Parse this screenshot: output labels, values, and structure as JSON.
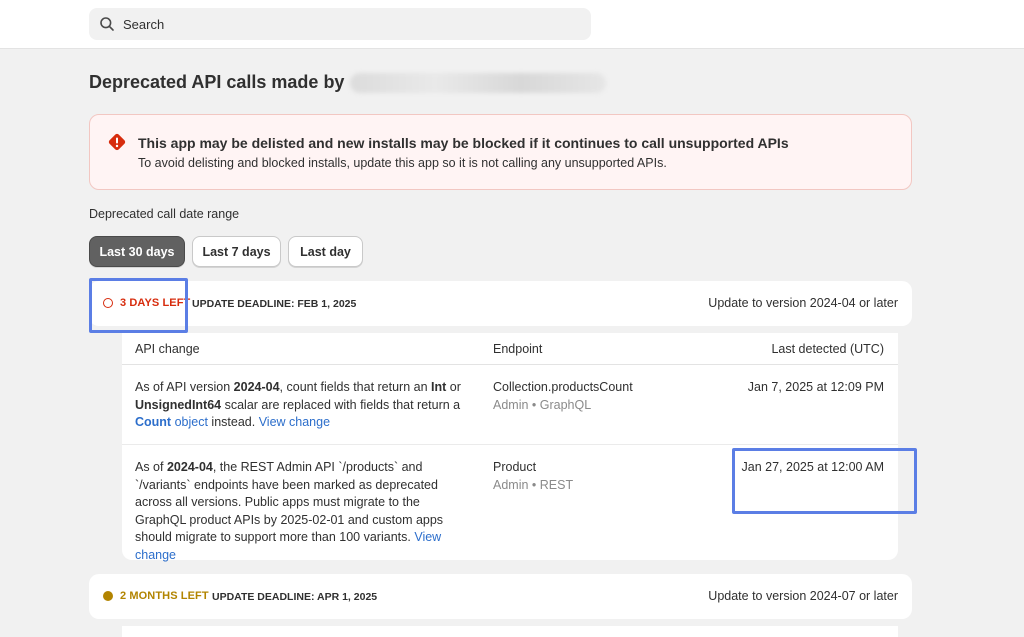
{
  "search": {
    "placeholder": "Search"
  },
  "page": {
    "title": "Deprecated API calls made by"
  },
  "banner": {
    "heading": "This app may be delisted and new installs may be blocked if it continues to call unsupported APIs",
    "body": "To avoid delisting and blocked installs, update this app so it is not calling any unsupported APIs."
  },
  "range": {
    "label": "Deprecated call date range",
    "options": [
      "Last 30 days",
      "Last 7 days",
      "Last day"
    ],
    "selected": "Last 30 days"
  },
  "table_headers": {
    "api": "API change",
    "endpoint": "Endpoint",
    "detected": "Last detected (UTC)"
  },
  "groups": [
    {
      "status": "3 DAYS LEFT",
      "status_color": "#d72c0d",
      "deadline": "UPDATE DEADLINE: FEB 1, 2025",
      "update": "Update to version 2024-04 or later",
      "rows": [
        {
          "api_parts": [
            "As of API version ",
            "2024-04",
            ", count fields that return an ",
            "Int",
            " or ",
            "UnsignedInt64",
            " scalar are replaced with fields that return a ",
            "Count",
            " object",
            " instead. ",
            "View change"
          ],
          "endpoint": "Collection.productsCount",
          "endpoint_sub": "Admin • GraphQL",
          "detected": "Jan 7, 2025 at 12:09 PM"
        },
        {
          "api_parts": [
            "As of ",
            "2024-04",
            ", the REST Admin API `/products` and `/variants` endpoints have been marked as deprecated across all versions. Public apps must migrate to the GraphQL product APIs by 2025-02-01 and custom apps should migrate to support more than 100 variants. ",
            "View change"
          ],
          "endpoint": "Product",
          "endpoint_sub": "Admin • REST",
          "detected": "Jan 27, 2025 at 12:00 AM"
        }
      ]
    },
    {
      "status": "2 MONTHS LEFT",
      "status_color": "#b28400",
      "deadline": "UPDATE DEADLINE: APR 1, 2025",
      "update": "Update to version 2024-07 or later"
    }
  ],
  "colors": {
    "accent_link": "#2c6ecb",
    "highlight": "#5b7ee5",
    "critical": "#d72c0d",
    "warning": "#b28400"
  },
  "icons": [
    "search-icon",
    "alert-diamond-icon",
    "status-circle-icon"
  ]
}
